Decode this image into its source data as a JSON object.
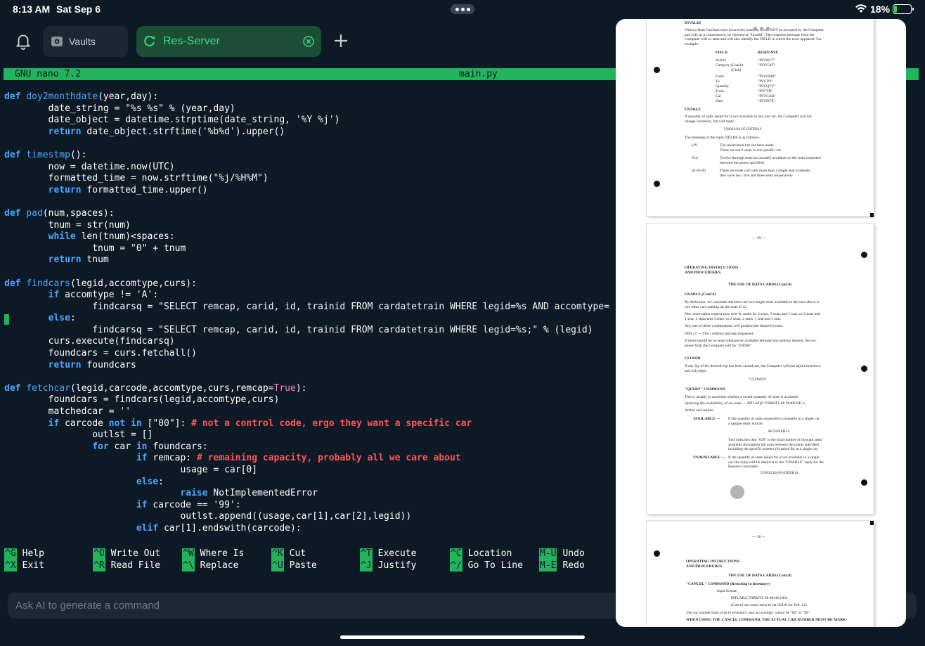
{
  "status": {
    "time": "8:13 AM",
    "date": "Sat Sep 6",
    "battery": "18%",
    "battery_level": 0.18
  },
  "tabs": [
    {
      "label": "Vaults",
      "icon": "vault-icon",
      "active": false
    },
    {
      "label": "Res-Server",
      "icon": "server-icon",
      "active": true
    }
  ],
  "nano": {
    "version": "GNU nano 7.2",
    "filename": "main.py"
  },
  "code_lines": [
    "def doy2monthdate(year,day):",
    "        date_string = \"%s %s\" % (year,day)",
    "        date_object = datetime.strptime(date_string, '%Y %j')",
    "        return date_object.strftime('%b%d').upper()",
    "",
    "def timestmp():",
    "        now = datetime.now(UTC)",
    "        formatted_time = now.strftime(\"%j/%H%M\")",
    "        return formatted_time.upper()",
    "",
    "def pad(num,spaces):",
    "        tnum = str(num)",
    "        while len(tnum)<spaces:",
    "                tnum = \"0\" + tnum",
    "        return tnum",
    "",
    "def findcars(legid,accomtype,curs):",
    "        if accomtype != 'A':",
    "                findcarsq = \"SELECT remcap, carid, id, trainid FROM cardatetrain WHERE legid=%s AND accomtype=",
    "        else:",
    "                findcarsq = \"SELECT remcap, carid, id, trainid FROM cardatetrain WHERE legid=%s;\" % (legid)",
    "        curs.execute(findcarsq)",
    "        foundcars = curs.fetchall()",
    "        return foundcars",
    "",
    "def fetchcar(legid,carcode,accomtype,curs,remcap=True):",
    "        foundcars = findcars(legid,accomtype,curs)",
    "        matchedcar = ''",
    "        if carcode not in [\"00\"]: # not a control code, ergo they want a specific car",
    "                outlst = []",
    "                for car in foundcars:",
    "                        if remcap: # remaining capacity, probably all we care about",
    "                                usage = car[0]",
    "                        else:",
    "                                raise NotImplementedError",
    "                        if carcode == '99':",
    "                                outlst.append((usage,car[1],car[2],legid))",
    "                        elif car[1].endswith(carcode):"
  ],
  "shortcuts": [
    {
      "key": "^G",
      "label": "Help"
    },
    {
      "key": "^X",
      "label": "Exit"
    },
    {
      "key": "^O",
      "label": "Write Out"
    },
    {
      "key": "^R",
      "label": "Read File"
    },
    {
      "key": "^W",
      "label": "Where Is"
    },
    {
      "key": "^\\",
      "label": "Replace"
    },
    {
      "key": "^K",
      "label": "Cut"
    },
    {
      "key": "^U",
      "label": "Paste"
    },
    {
      "key": "^T",
      "label": "Execute"
    },
    {
      "key": "^J",
      "label": "Justify"
    },
    {
      "key": "^C",
      "label": "Location"
    },
    {
      "key": "^/",
      "label": "Go To Line"
    },
    {
      "key": "M-U",
      "label": "Undo"
    },
    {
      "key": "M-E",
      "label": "Redo"
    }
  ],
  "ai_input": {
    "placeholder": "Ask AI to generate a command"
  },
  "document": {
    "page1": {
      "heading": "INVALID",
      "intro": [
        "When a Data Card has been incorrectly marked, it will NOT be accepted by the Computer",
        "and will, as a consequence, be rejected as \"Invalid\". The response message from the",
        "Computer will so state and will also identify the FIELD in which the error appeared. For",
        "example:-"
      ],
      "col_field": "FIELD",
      "col_response": "RESPONSE",
      "rows": [
        [
          "Action",
          "\"INVACT\""
        ],
        [
          "Category (Coach)",
          "\"INVCAT\""
        ],
        [
          "(Club)",
          ""
        ],
        [
          "From",
          "\"INVFRM\""
        ],
        [
          "To",
          "\"INVTO\""
        ],
        [
          "Quantity",
          "\"INVQTY\""
        ],
        [
          "Train",
          "\"INVTR\""
        ],
        [
          "Car",
          "\"INVCAR\""
        ],
        [
          "Date",
          "\"INVDTE\""
        ]
      ],
      "unable_heading": "UNABLE",
      "unable_text": [
        "If quantity of seats asked for is not available in any one car, the Computer will not",
        "change inventory, but will reply:"
      ],
      "unable_reply": "UN012/02-05-03FEB12",
      "meaning": "The meaning of the reply FIELDS is as follows:-",
      "defs": [
        {
          "term": "UN",
          "desc": [
            "The reservation has not been made.",
            "There are not 8 seats in one specific car."
          ]
        },
        {
          "term": "012/",
          "desc": [
            "Twelve through seats are actually available on the train requested",
            "between the points specified."
          ]
        },
        {
          "term": "02-05-03",
          "desc": [
            "There are three cars with more than a single seat available;",
            "they have two, five and three seats respectively."
          ]
        }
      ]
    },
    "page2": {
      "page_no": "— 29 —",
      "header": [
        "OPERATING INSTRUCTIONS",
        "AND PROCEDURES"
      ],
      "title": "THE USE OF DATA CARDS  (Cont'd)",
      "sub": "UNABLE  (Cont'd)",
      "lines": [
        "By deduction, we conclude that there are two single seats available in the case above in",
        "two other cars making up the total of 12.",
        "",
        "New reservation request may now be made for 2 seats, 3 seats and 1 seat; or 3 seats and",
        "1 seat; 3 seats and 3 seats; or 2 seats, 2 seats, 1 seat and 1 seat.",
        "",
        "Any one of these combinations will produce the desired 6 seats.",
        "",
        "FEB 12 — This confirms the date requested.",
        "",
        "If there should be no seats whatsoever available between the stations desired, the res-",
        "ponse from the Computer will be \"UN000\"."
      ],
      "closed_heading": "CLOSED",
      "closed_text": [
        "If any leg of the desired trip has been closed out, the Computer will not adjust inventory",
        "and will reply:"
      ],
      "closed_reply": "\"CLOSED\"",
      "query_heading": "\"QUERY\" COMMAND",
      "query_lines": [
        "This is usually to ascertain whether a certain quantity of seats is available.",
        "Querying the availability of six seats — MTLAQZ TORMTL 06 06400 045 e",
        "Action and replies:"
      ],
      "available_label": "AVAILABLE  —",
      "available_text": [
        "If the quantity of seats requested is available in a single car",
        "a sample reply will be:"
      ],
      "available_reply": "AV039FEB14",
      "available_note": [
        "This indicates that \"039\" is the total number of through seats",
        "available throughout the train between the points specified,",
        "including the specific number (6) asked for in a single car."
      ],
      "unavailable_label": "UNAVAILABLE  —",
      "unavailable_text": [
        "If the quantity of seats asked for is not available in a single",
        "car, the reply will be identical to the \"UNABLE\" reply for the",
        "Reserve command:-"
      ],
      "unavailable_reply": "UN012/02-05-03FEB14"
    },
    "page3": {
      "page_no": "— 30 —",
      "header": [
        "OPERATING INSTRUCTIONS",
        "AND PROCEDURES"
      ],
      "title": "THE USE OF DATA CARDS  (Cont'd)",
      "cancel_heading": "\"CANCEL\" COMMAND  (Restoring to Inventory)",
      "input_format": "Input format:",
      "cancel_example": "MTLAKZ  TORMTL  06 06410 045e",
      "cancel_note": "(Cancel six coach seats in car 06410 for Feb. 14).",
      "rule": "The car number must exist in inventory, and accordingly cannot be \"00\" or \"99\".",
      "warning": "WHEN USING THE CANCEL COMMAND, THE ACTUAL CAR NUMBER MUST BE MARK-"
    }
  }
}
